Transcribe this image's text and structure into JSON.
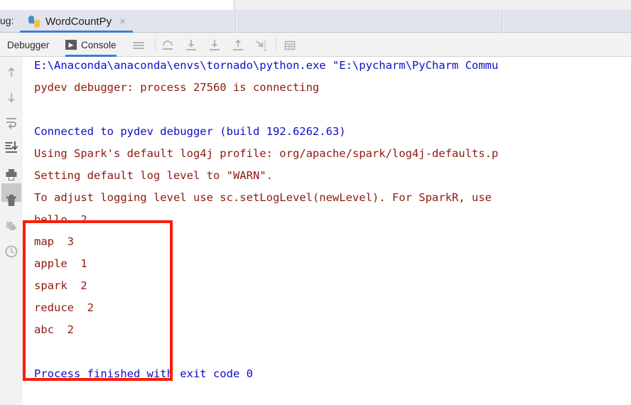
{
  "window": {
    "tool_window_label": "ug:",
    "run_config_name": "WordCountPy",
    "close_glyph": "×",
    "python_icon": "python-logo-icon"
  },
  "tool_tabs": [
    {
      "id": "debugger",
      "label": "Debugger",
      "active": false
    },
    {
      "id": "console",
      "label": "Console",
      "active": true,
      "glyph": "▶"
    }
  ],
  "toolbar": {
    "icons": [
      {
        "name": "menu-icon",
        "title": "Settings"
      },
      {
        "name": "step-over-icon",
        "title": "Step Over"
      },
      {
        "name": "step-into-icon",
        "title": "Step Into"
      },
      {
        "name": "force-step-into-icon",
        "title": "Force Step Into"
      },
      {
        "name": "step-out-icon",
        "title": "Step Out"
      },
      {
        "name": "run-to-cursor-icon",
        "title": "Run to Cursor"
      },
      {
        "name": "evaluate-expression-icon",
        "title": "Evaluate Expression"
      }
    ]
  },
  "gutter": {
    "icons": [
      {
        "name": "up-arrow-icon",
        "title": "Previous Occurrence"
      },
      {
        "name": "down-arrow-icon",
        "title": "Next Occurrence"
      },
      {
        "name": "soft-wrap-icon",
        "title": "Use Soft Wraps"
      },
      {
        "name": "scroll-to-end-icon",
        "title": "Scroll to the End",
        "selected": true
      },
      {
        "name": "print-icon",
        "title": "Print"
      },
      {
        "name": "trash-icon",
        "title": "Clear All"
      },
      {
        "name": "export-icon",
        "title": "Export to Text File"
      },
      {
        "name": "clock-icon",
        "title": "History"
      }
    ]
  },
  "console": {
    "lines": [
      {
        "text": "E:\\Anaconda\\anaconda\\envs\\tornado\\python.exe \"E:\\pycharm\\PyCharm Commu",
        "color": "blue"
      },
      {
        "text": "pydev debugger: process 27560 is connecting",
        "color": "dred"
      },
      {
        "text": "",
        "color": "dred"
      },
      {
        "text": "Connected to pydev debugger (build 192.6262.63)",
        "color": "blue"
      },
      {
        "text": "Using Spark's default log4j profile: org/apache/spark/log4j-defaults.p",
        "color": "dred"
      },
      {
        "text": "Setting default log level to \"WARN\".",
        "color": "dred"
      },
      {
        "text": "To adjust logging level use sc.setLogLevel(newLevel). For SparkR, use",
        "color": "dred"
      },
      {
        "text": "hello  2",
        "color": "dred"
      },
      {
        "text": "map  3",
        "color": "dred"
      },
      {
        "text": "apple  1",
        "color": "dred"
      },
      {
        "text": "spark  2",
        "color": "dred"
      },
      {
        "text": "reduce  2",
        "color": "dred"
      },
      {
        "text": "abc  2",
        "color": "dred"
      },
      {
        "text": "",
        "color": "dred"
      },
      {
        "text": "Process finished with exit code 0",
        "color": "blue"
      }
    ]
  },
  "word_counts": [
    {
      "word": "hello",
      "count": 2
    },
    {
      "word": "map",
      "count": 3
    },
    {
      "word": "apple",
      "count": 1
    },
    {
      "word": "spark",
      "count": 2
    },
    {
      "word": "reduce",
      "count": 2
    },
    {
      "word": "abc",
      "count": 2
    }
  ],
  "annotation": {
    "name": "red-highlight-rectangle",
    "color": "#fc1c0a"
  },
  "colors": {
    "console_blue": "#0e0ec4",
    "console_dark_red": "#8c1a0e",
    "tab_active_underline": "#3c7fd0",
    "tab_bar_bg": "#e1e4ec",
    "toolbar_bg": "#f2f2f2"
  }
}
